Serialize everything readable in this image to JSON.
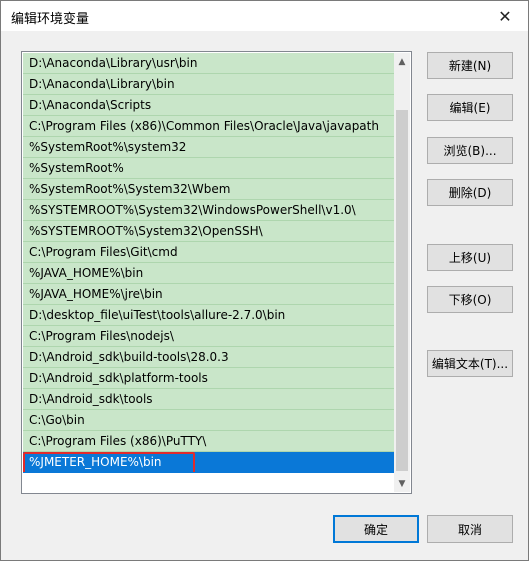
{
  "window": {
    "title": "编辑环境变量",
    "close_label": "✕"
  },
  "paths": [
    {
      "text": "D:\\Anaconda\\Library\\usr\\bin"
    },
    {
      "text": "D:\\Anaconda\\Library\\bin"
    },
    {
      "text": "D:\\Anaconda\\Scripts"
    },
    {
      "text": "C:\\Program Files (x86)\\Common Files\\Oracle\\Java\\javapath"
    },
    {
      "text": "%SystemRoot%\\system32"
    },
    {
      "text": "%SystemRoot%"
    },
    {
      "text": "%SystemRoot%\\System32\\Wbem"
    },
    {
      "text": "%SYSTEMROOT%\\System32\\WindowsPowerShell\\v1.0\\"
    },
    {
      "text": "%SYSTEMROOT%\\System32\\OpenSSH\\"
    },
    {
      "text": "C:\\Program Files\\Git\\cmd"
    },
    {
      "text": "%JAVA_HOME%\\bin"
    },
    {
      "text": "%JAVA_HOME%\\jre\\bin"
    },
    {
      "text": "D:\\desktop_file\\uiTest\\tools\\allure-2.7.0\\bin"
    },
    {
      "text": "C:\\Program Files\\nodejs\\"
    },
    {
      "text": "D:\\Android_sdk\\build-tools\\28.0.3"
    },
    {
      "text": "D:\\Android_sdk\\platform-tools"
    },
    {
      "text": "D:\\Android_sdk\\tools"
    },
    {
      "text": "C:\\Go\\bin"
    },
    {
      "text": "C:\\Program Files (x86)\\PuTTY\\"
    },
    {
      "text": "%JMETER_HOME%\\bin"
    }
  ],
  "selected_index": 19,
  "scrollbar": {
    "up_icon": "▲",
    "down_icon": "▼"
  },
  "buttons": {
    "new": "新建(N)",
    "edit": "编辑(E)",
    "browse": "浏览(B)...",
    "delete": "删除(D)",
    "move_up": "上移(U)",
    "move_down": "下移(O)",
    "edit_text": "编辑文本(T)...",
    "ok": "确定",
    "cancel": "取消"
  },
  "colors": {
    "row_bg": "#c9e6c9",
    "selected_bg": "#0a78d7",
    "highlight_border": "#e22b2b"
  }
}
